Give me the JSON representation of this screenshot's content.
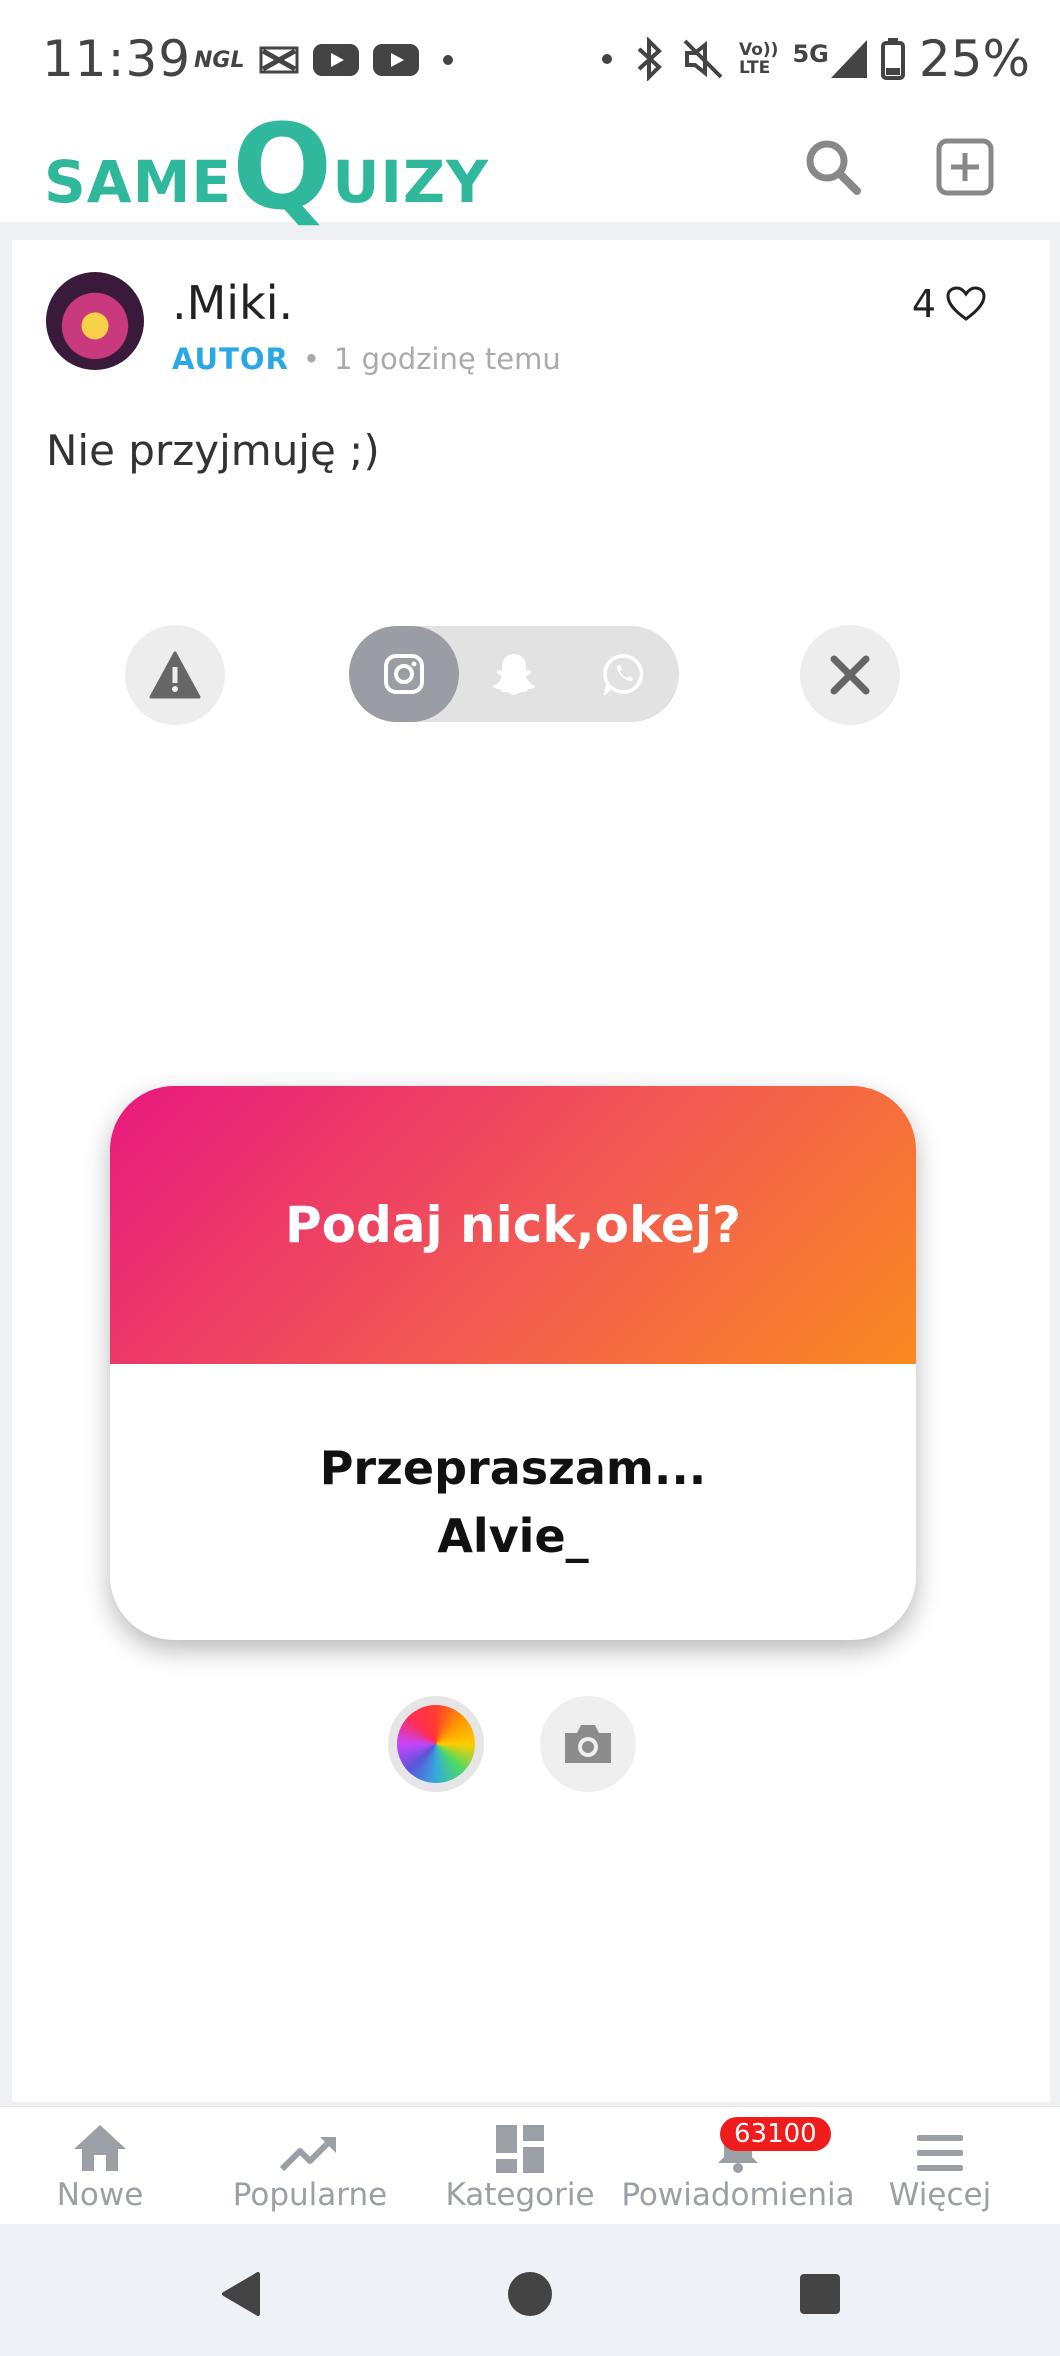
{
  "status_bar": {
    "time": "11:39",
    "left_icons": [
      "ngl-icon",
      "capcut-icon",
      "youtube-icon",
      "youtube-icon",
      "dot-icon"
    ],
    "ngl_label": "NGL",
    "network_top": "Vo))",
    "network_bottom": "LTE",
    "network_gen": "5G",
    "battery": "25%"
  },
  "header": {
    "logo_same": "SAME",
    "logo_q": "Q",
    "logo_uizy": "UIZY",
    "search_icon": "search-icon",
    "add_icon": "add-square-icon"
  },
  "post": {
    "username": ".Miki.",
    "role": "AUTOR",
    "separator": "•",
    "time_ago": "1 godzinę temu",
    "likes": "4",
    "comment": "Nie przyjmuję ;)"
  },
  "share": {
    "options": [
      "instagram-icon",
      "snapchat-icon",
      "whatsapp-icon"
    ],
    "active_index": 0
  },
  "question_card": {
    "question": "Podaj nick,okej?",
    "answer_line1": "Przepraszam...",
    "answer_line2": "Alvie_",
    "gradient": [
      "#e8197e",
      "#f25a52",
      "#fa8a20"
    ]
  },
  "bottom_nav": {
    "items": [
      {
        "label": "Nowe",
        "icon": "home-icon"
      },
      {
        "label": "Popularne",
        "icon": "trending-icon"
      },
      {
        "label": "Kategorie",
        "icon": "grid-icon"
      },
      {
        "label": "Powiadomienia",
        "icon": "bell-icon"
      },
      {
        "label": "Więcej",
        "icon": "menu-icon"
      }
    ],
    "notification_badge": "63100"
  },
  "colors": {
    "brand": "#2fb89c",
    "role": "#2aa8e6",
    "badge": "#ee1c1c"
  }
}
